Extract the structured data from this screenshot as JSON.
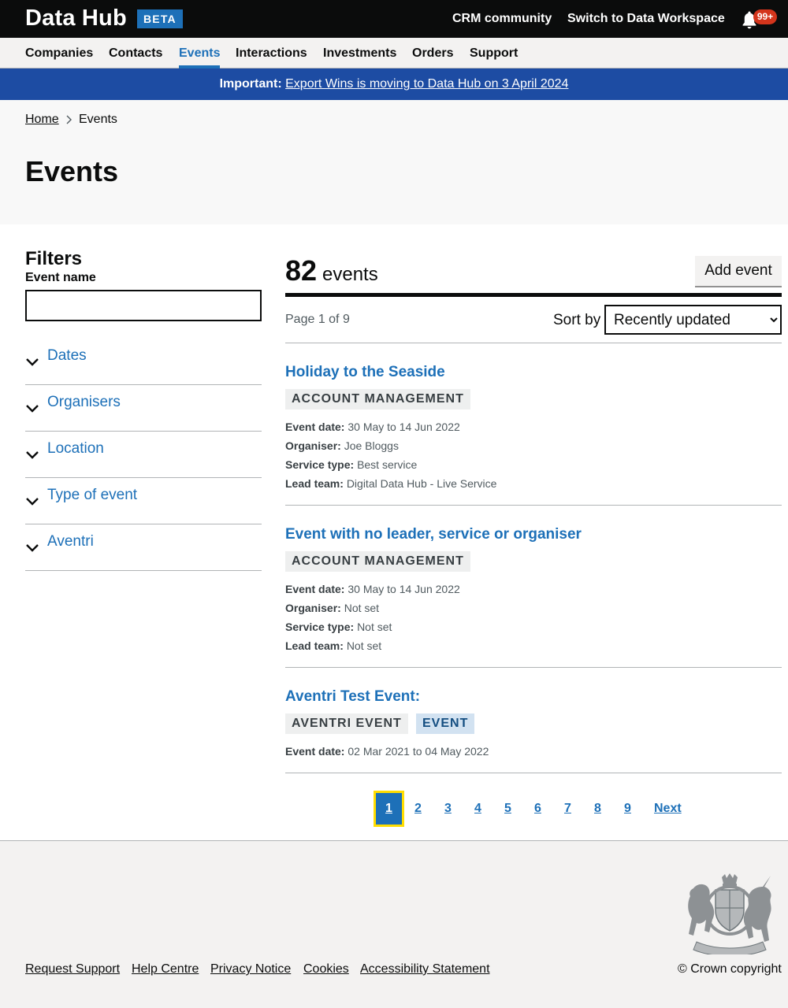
{
  "header": {
    "brand": "Data Hub",
    "beta": "BETA",
    "links": [
      "CRM community",
      "Switch to Data Workspace"
    ],
    "notification_count": "99+"
  },
  "nav": [
    "Companies",
    "Contacts",
    "Events",
    "Interactions",
    "Investments",
    "Orders",
    "Support"
  ],
  "nav_active": "Events",
  "banner": {
    "prefix": "Important:",
    "link": "Export Wins is moving to Data Hub on 3 April 2024"
  },
  "breadcrumb": {
    "home": "Home",
    "current": "Events"
  },
  "page_title": "Events",
  "filters": {
    "heading": "Filters",
    "event_name_label": "Event name",
    "event_name_value": "",
    "sections": [
      "Dates",
      "Organisers",
      "Location",
      "Type of event",
      "Aventri"
    ]
  },
  "results": {
    "count": "82",
    "count_label": "events",
    "add_button": "Add event",
    "page_info": "Page 1 of 9",
    "sort_label": "Sort by",
    "sort_value": "Recently updated"
  },
  "events": [
    {
      "title": "Holiday to the Seaside",
      "tags": [
        "ACCOUNT MANAGEMENT"
      ],
      "meta": [
        {
          "k": "Event date:",
          "v": "30 May to 14 Jun 2022"
        },
        {
          "k": "Organiser:",
          "v": "Joe Bloggs"
        },
        {
          "k": "Service type:",
          "v": "Best service"
        },
        {
          "k": "Lead team:",
          "v": "Digital Data Hub - Live Service"
        }
      ]
    },
    {
      "title": "Event with no leader, service or organiser",
      "tags": [
        "ACCOUNT MANAGEMENT"
      ],
      "meta": [
        {
          "k": "Event date:",
          "v": "30 May to 14 Jun 2022"
        },
        {
          "k": "Organiser:",
          "v": "Not set"
        },
        {
          "k": "Service type:",
          "v": "Not set"
        },
        {
          "k": "Lead team:",
          "v": "Not set"
        }
      ]
    },
    {
      "title": "Aventri Test Event",
      "title_suffix": ":",
      "tags": [
        "AVENTRI EVENT",
        "EVENT"
      ],
      "meta": [
        {
          "k": "Event date:",
          "v": "02 Mar 2021 to 04 May 2022"
        }
      ]
    }
  ],
  "pagination": {
    "current": "1",
    "pages": [
      "2",
      "3",
      "4",
      "5",
      "6",
      "7",
      "8",
      "9"
    ],
    "next": "Next"
  },
  "footer": {
    "links": [
      "Request Support",
      "Help Centre",
      "Privacy Notice",
      "Cookies",
      "Accessibility Statement"
    ],
    "copyright": "© Crown copyright"
  },
  "colors": {
    "link_blue": "#1d70b8",
    "banner_blue": "#1d4ca3",
    "header_black": "#0b0c0c",
    "focus_yellow": "#ffdd00",
    "badge_red": "#d4351c"
  }
}
